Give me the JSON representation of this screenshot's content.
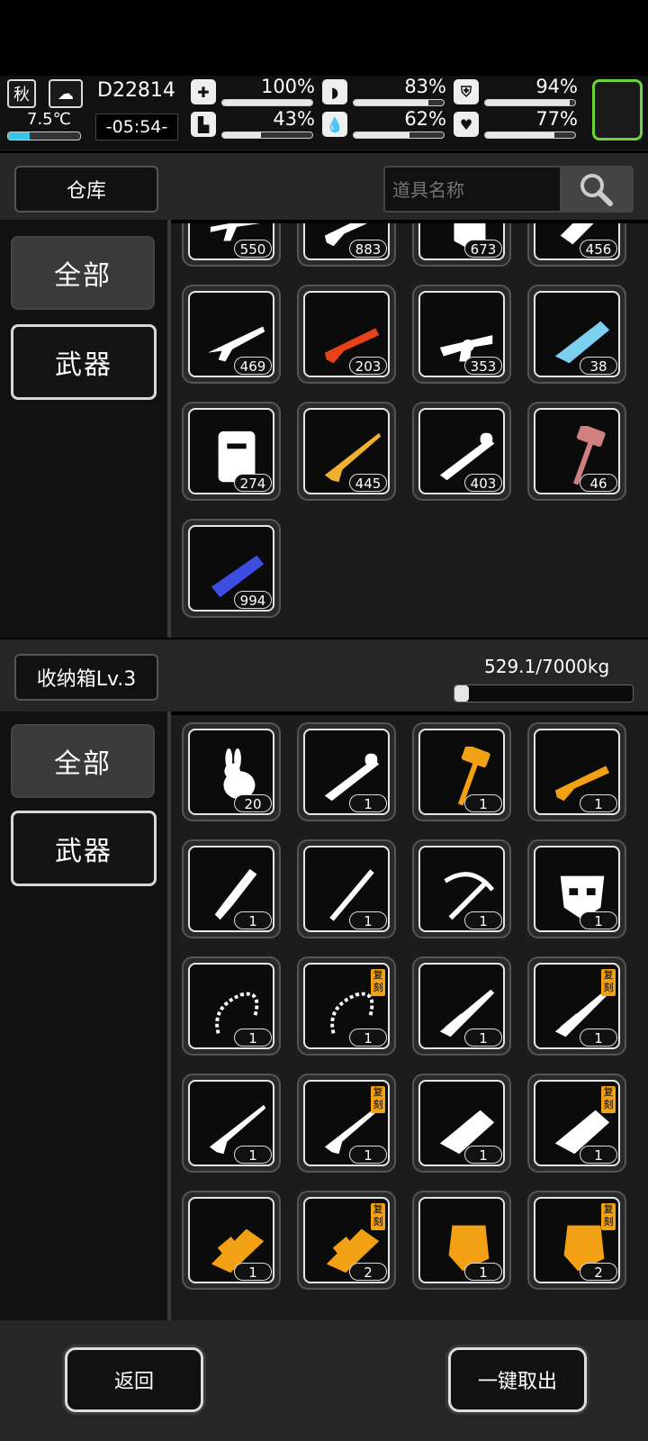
{
  "status": {
    "season": "秋",
    "temperature": "7.5℃",
    "day": "D22814",
    "time": "-05:54-",
    "stats": [
      {
        "name": "health",
        "icon": "medkit-icon",
        "value": "100%",
        "fill": 1.0
      },
      {
        "name": "hunger",
        "icon": "stomach-icon",
        "value": "83%",
        "fill": 0.83
      },
      {
        "name": "armor",
        "icon": "shield-icon",
        "value": "94%",
        "fill": 0.94
      },
      {
        "name": "stamina",
        "icon": "boot-icon",
        "value": "43%",
        "fill": 0.43
      },
      {
        "name": "thirst",
        "icon": "water-drop-icon",
        "value": "62%",
        "fill": 0.62
      },
      {
        "name": "mood",
        "icon": "heart-icon",
        "value": "77%",
        "fill": 0.77
      }
    ],
    "temperature_fill": 0.3,
    "accent": "#6fd43a"
  },
  "warehouse": {
    "title": "仓库",
    "search_placeholder": "道具名称",
    "tabs": [
      "全部",
      "武器"
    ],
    "items": [
      {
        "count": "550",
        "icon": "assault-rifle-icon",
        "color": "#ffffff"
      },
      {
        "count": "883",
        "icon": "shotgun-icon",
        "color": "#ffffff"
      },
      {
        "count": "673",
        "icon": "shield-icon",
        "color": "#ffffff"
      },
      {
        "count": "456",
        "icon": "cannon-icon",
        "color": "#ffffff"
      },
      {
        "count": "469",
        "icon": "rifle-icon",
        "color": "#ffffff"
      },
      {
        "count": "203",
        "icon": "shotgun-icon",
        "color": "#e8421a"
      },
      {
        "count": "353",
        "icon": "grenade-launcher-icon",
        "color": "#ffffff"
      },
      {
        "count": "38",
        "icon": "plasma-gun-icon",
        "color": "#7ad0ee"
      },
      {
        "count": "274",
        "icon": "riot-shield-icon",
        "color": "#ffffff"
      },
      {
        "count": "445",
        "icon": "sniper-rifle-icon",
        "color": "#f0b030"
      },
      {
        "count": "403",
        "icon": "rocket-launcher-icon",
        "color": "#ffffff"
      },
      {
        "count": "46",
        "icon": "hammer-icon",
        "color": "#d08080"
      },
      {
        "count": "994",
        "icon": "minigun-icon",
        "color": "#3b4ee0"
      }
    ]
  },
  "storage": {
    "title": "收纳箱Lv.3",
    "capacity": "529.1/7000kg",
    "capacity_fill": 0.0756,
    "tabs": [
      "全部",
      "武器"
    ],
    "items": [
      {
        "count": "20",
        "icon": "rabbit-icon",
        "color": "#ffffff",
        "tag": ""
      },
      {
        "count": "1",
        "icon": "rocket-launcher-icon",
        "color": "#ffffff",
        "tag": ""
      },
      {
        "count": "1",
        "icon": "hammer-icon",
        "color": "#f2a014",
        "tag": ""
      },
      {
        "count": "1",
        "icon": "shotgun-icon",
        "color": "#f2a014",
        "tag": ""
      },
      {
        "count": "1",
        "icon": "brush-icon",
        "color": "#ffffff",
        "tag": ""
      },
      {
        "count": "1",
        "icon": "staff-icon",
        "color": "#ffffff",
        "tag": ""
      },
      {
        "count": "1",
        "icon": "crossbow-icon",
        "color": "#ffffff",
        "tag": ""
      },
      {
        "count": "1",
        "icon": "mask-icon",
        "color": "#ffffff",
        "tag": ""
      },
      {
        "count": "1",
        "icon": "whip-icon",
        "color": "#ffffff",
        "tag": ""
      },
      {
        "count": "1",
        "icon": "whip-icon",
        "color": "#ffffff",
        "tag": "复刻"
      },
      {
        "count": "1",
        "icon": "spear-gun-icon",
        "color": "#ffffff",
        "tag": ""
      },
      {
        "count": "1",
        "icon": "spear-gun-icon",
        "color": "#ffffff",
        "tag": "复刻"
      },
      {
        "count": "1",
        "icon": "sniper-rifle-icon",
        "color": "#ffffff",
        "tag": ""
      },
      {
        "count": "1",
        "icon": "sniper-rifle-icon",
        "color": "#ffffff",
        "tag": "复刻"
      },
      {
        "count": "1",
        "icon": "heavy-gun-icon",
        "color": "#ffffff",
        "tag": ""
      },
      {
        "count": "1",
        "icon": "heavy-gun-icon",
        "color": "#ffffff",
        "tag": "复刻"
      },
      {
        "count": "1",
        "icon": "blaster-icon",
        "color": "#f2a014",
        "tag": ""
      },
      {
        "count": "2",
        "icon": "blaster-icon",
        "color": "#f2a014",
        "tag": "复刻"
      },
      {
        "count": "1",
        "icon": "axe-gun-icon",
        "color": "#f2a014",
        "tag": ""
      },
      {
        "count": "2",
        "icon": "axe-gun-icon",
        "color": "#f2a014",
        "tag": "复刻"
      }
    ]
  },
  "footer": {
    "back_label": "返回",
    "take_all_label": "一键取出"
  }
}
